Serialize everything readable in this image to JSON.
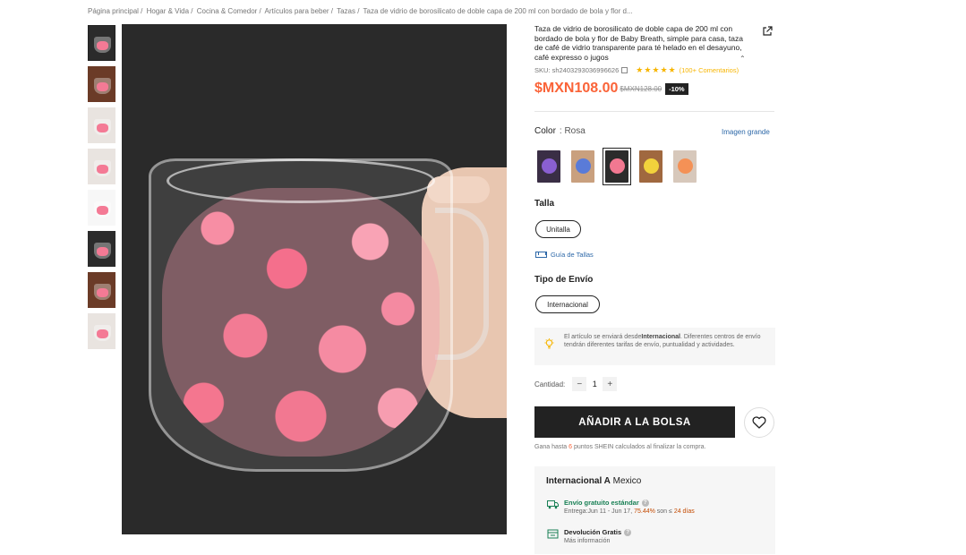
{
  "breadcrumb": {
    "items": [
      "Página principal /",
      "Hogar & Vida /",
      "Cocina & Comedor /",
      "Artículos para beber /",
      "Tazas /",
      "Taza de vidrio de borosilicato de doble capa de 200 ml con bordado de bola y flor d..."
    ]
  },
  "product": {
    "title": "Taza de vidrio de borosilicato de doble capa de 200 ml con bordado de bola y flor de Baby Breath, simple para casa, taza de café de vidrio transparente para té helado en el desayuno, café expresso o jugos",
    "sku": "SKU: sh2403293036996626",
    "stars": "★★★★★",
    "reviews": "(100+ Comentarios)",
    "price": "$MXN108.00",
    "old_price": "$MXN128.00",
    "discount": "-10%"
  },
  "color": {
    "label": "Color",
    "value": ": Rosa",
    "big_image_link": "Imagen grande",
    "swatches": [
      "Morado",
      "Azul",
      "Rosa",
      "Amarillo",
      "Naranja"
    ],
    "selected_index": 2
  },
  "size": {
    "label": "Talla",
    "option": "Unitalla",
    "guide": "Guía de Tallas"
  },
  "shipping_type": {
    "label": "Tipo de Envío",
    "option": "Internacional"
  },
  "notice": {
    "text_before": "El artículo se enviará desde",
    "bold": "Internacional",
    "text_after": ". Diferentes centros de envío tendrán diferentes tarifas de envío, puntualidad y actividades."
  },
  "quantity": {
    "label": "Cantidad:",
    "minus": "−",
    "value": "1",
    "plus": "+"
  },
  "cart": {
    "add_label": "AÑADIR A LA BOLSA"
  },
  "points": {
    "before": "Gana hasta ",
    "value": "6",
    "after": " puntos SHEIN calculados al finalizar la compra."
  },
  "ship_box": {
    "title_bold": "Internacional A",
    "title_rest": " Mexico",
    "free_title": "Envío gratuito estándar",
    "free_detail_before": "Entrega:Jun 11 - Jun 17, ",
    "free_detail_pct": "75.44%",
    "free_detail_mid": " son ≤ ",
    "free_detail_days": "24 días",
    "return_title": "Devolución Gratis",
    "return_detail": "Más información"
  },
  "colors": {
    "price": "#fa6338",
    "link": "#2d68a8",
    "primary_button": "#222222",
    "free_shipping": "#198055",
    "stars": "#f7b500"
  },
  "icons": [
    "share-icon",
    "collapse-icon",
    "copy-icon",
    "ruler-icon",
    "bulb-icon",
    "heart-icon",
    "truck-icon",
    "return-icon",
    "help-icon"
  ]
}
